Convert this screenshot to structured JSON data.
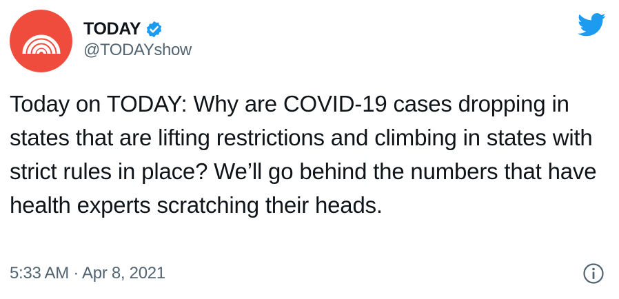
{
  "author": {
    "display_name": "TODAY",
    "handle": "@TODAYshow",
    "verified": true,
    "avatar_icon": "today-rainbow-logo",
    "avatar_color": "#f04c3d"
  },
  "tweet": {
    "text": "Today on TODAY: Why are COVID-19 cases dropping in states that are lifting restrictions and climbing in states with strict rules in place? We’ll go behind the numbers that have health experts scratching their heads.",
    "timestamp": "5:33 AM · Apr 8, 2021"
  },
  "icons": {
    "brand": "twitter-bird-icon",
    "verified": "verified-badge-icon",
    "info": "info-icon"
  },
  "colors": {
    "twitter_blue": "#1d9bf0",
    "text": "#0f1419",
    "secondary_text": "#536471"
  }
}
